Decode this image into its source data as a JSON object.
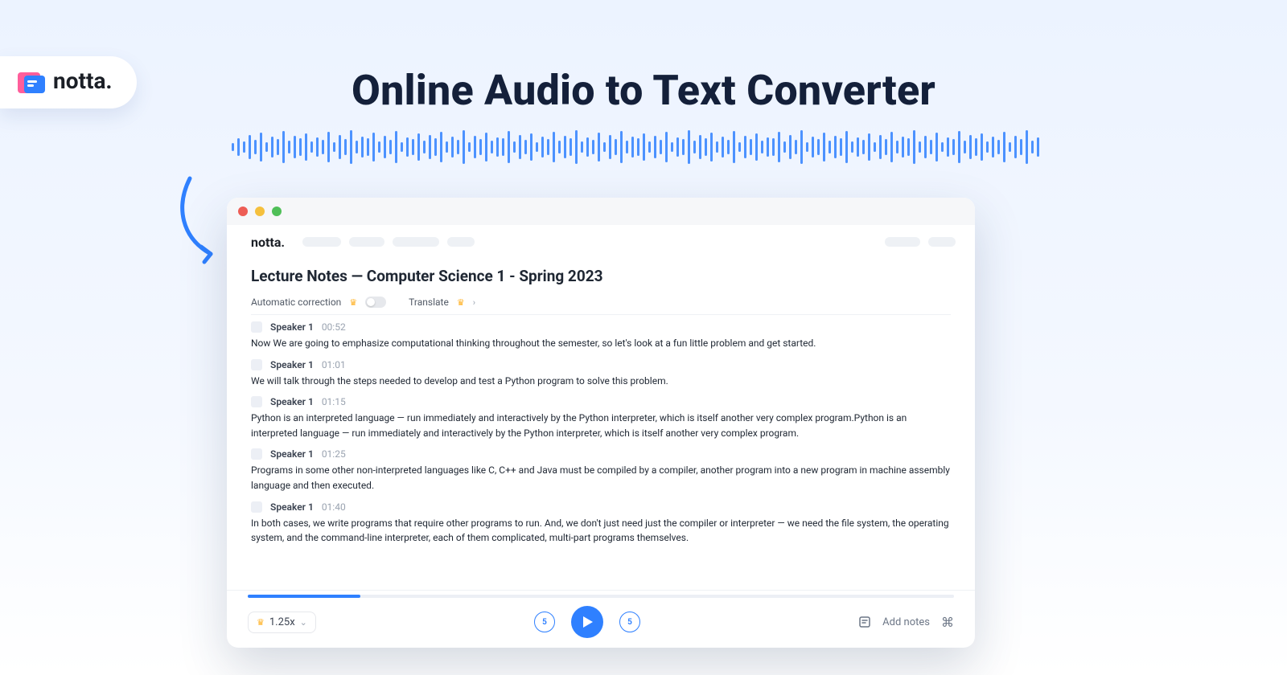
{
  "brand": "notta.",
  "headline": "Online Audio to Text Converter",
  "window": {
    "brand": "notta.",
    "doc_title": "Lecture Notes — Computer Science 1 - Spring 2023",
    "tools": {
      "auto_correction_label": "Automatic correction",
      "translate_label": "Translate"
    },
    "segments": [
      {
        "speaker": "Speaker 1",
        "ts": "00:52",
        "text": "Now We are going to emphasize computational thinking throughout the semester, so let's look at a fun little problem and get started."
      },
      {
        "speaker": "Speaker 1",
        "ts": "01:01",
        "text": "We will talk through the steps needed to develop and test a Python program to solve this problem."
      },
      {
        "speaker": "Speaker 1",
        "ts": "01:15",
        "text": "Python is an interpreted language — run immediately and interactively by the Python interpreter, which is itself another very complex program.Python is an interpreted language — run immediately and interactively by the Python interpreter, which is itself another very complex program."
      },
      {
        "speaker": "Speaker 1",
        "ts": "01:25",
        "text": "Programs in some other non-interpreted languages like C, C++ and Java must be compiled by a compiler, another program into a new program in machine assembly language and then executed."
      },
      {
        "speaker": "Speaker 1",
        "ts": "01:40",
        "text": "In both cases, we write programs that require other programs to run. And, we don't just need just the compiler or interpreter — we need the file system, the operating system, and the command-line interpreter, each of them complicated, multi-part programs themselves."
      }
    ],
    "player": {
      "speed": "1.25x",
      "rewind_label": "5",
      "forward_label": "5",
      "add_notes": "Add notes"
    }
  }
}
